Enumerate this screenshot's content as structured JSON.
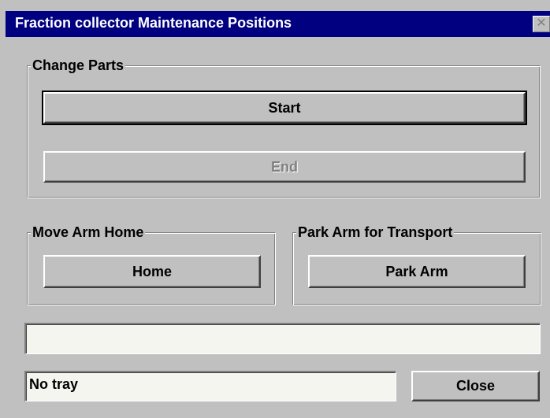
{
  "window": {
    "title": "Fraction collector Maintenance Positions",
    "close_glyph": "✕"
  },
  "change_parts": {
    "label": "Change Parts",
    "start_label": "Start",
    "end_label": "End"
  },
  "move_arm_home": {
    "label": "Move Arm Home",
    "home_label": "Home"
  },
  "park_arm": {
    "label": "Park Arm for Transport",
    "park_label": "Park Arm"
  },
  "status": {
    "message": "",
    "tray": "No tray"
  },
  "footer": {
    "close_label": "Close"
  },
  "colors": {
    "titlebar": "#000080",
    "face": "#c0c0c0"
  }
}
